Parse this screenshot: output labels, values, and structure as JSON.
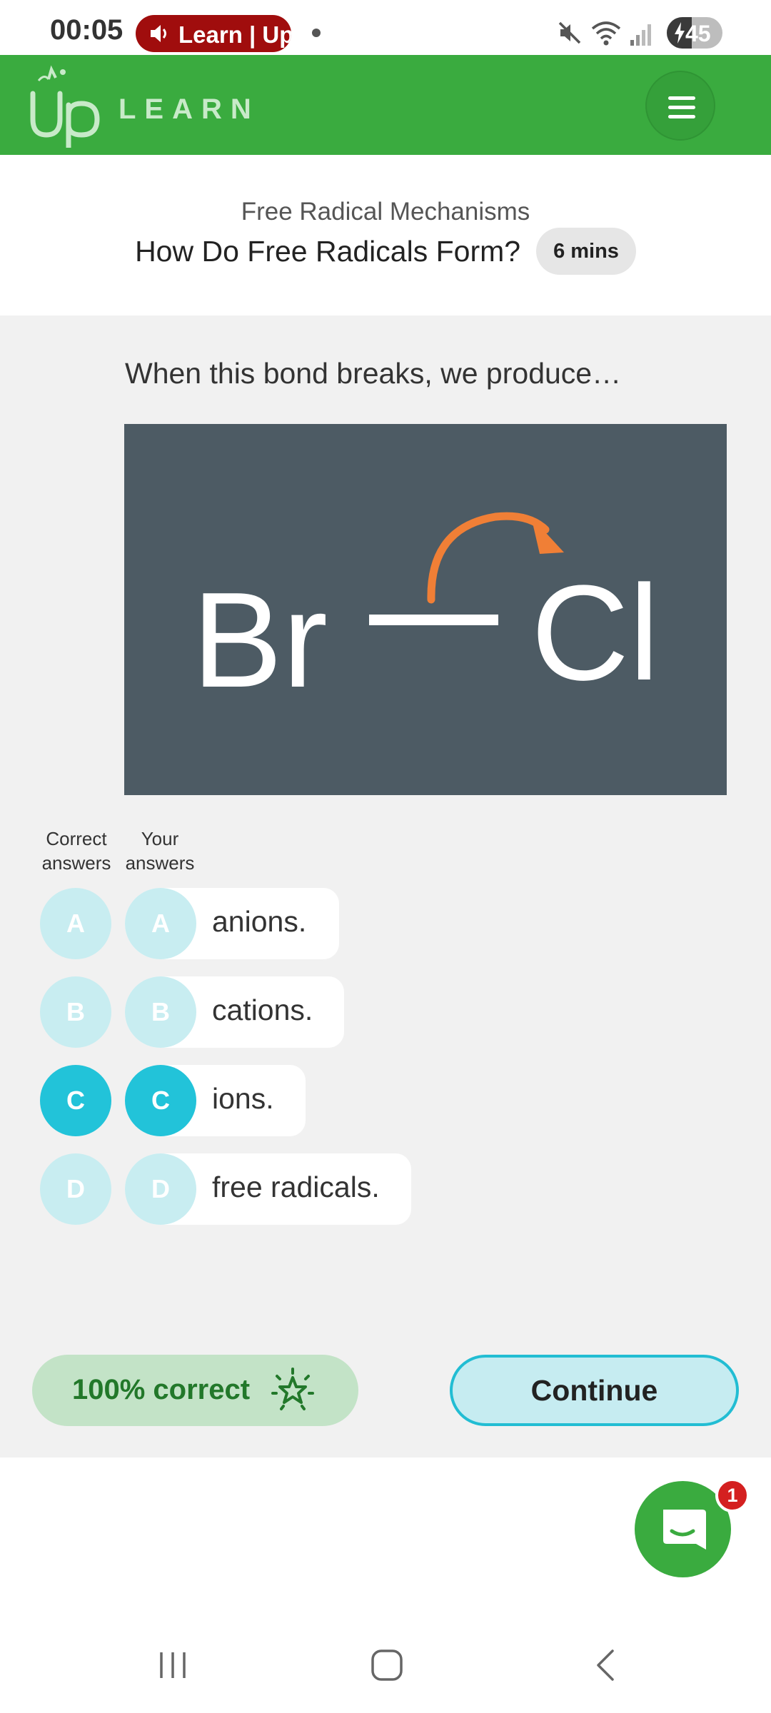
{
  "status_bar": {
    "time": "00:05",
    "media_label": "Learn | Up",
    "battery_level": "45",
    "battery_fraction": 0.45,
    "icons": [
      "speaker-icon",
      "mute-icon",
      "wifi-icon",
      "signal-icon",
      "battery-charging-icon"
    ]
  },
  "header": {
    "brand_prefix": "Up",
    "brand_word": "LEARN",
    "menu_icon": "hamburger-menu-icon"
  },
  "lesson": {
    "subtitle": "Free Radical Mechanisms",
    "title": "How Do Free Radicals Form?",
    "duration": "6 mins"
  },
  "question": {
    "prompt": "When this bond breaks, we produce…",
    "image": {
      "left_atom": "Br",
      "right_atom": "Cl",
      "arrow_icon": "curved-arrow-icon"
    }
  },
  "answers": {
    "correct_header": "Correct answers",
    "your_header": "Your answers",
    "options": [
      {
        "letter": "A",
        "text": "anions.",
        "selected": false
      },
      {
        "letter": "B",
        "text": "cations.",
        "selected": false
      },
      {
        "letter": "C",
        "text": "ions.",
        "selected": true
      },
      {
        "letter": "D",
        "text": "free radicals.",
        "selected": false
      }
    ]
  },
  "result": {
    "score_label": "100% correct",
    "score_icon": "star-burst-icon",
    "continue_label": "Continue"
  },
  "chat": {
    "icon": "chat-bubble-icon",
    "badge_count": "1"
  },
  "colors": {
    "brand_green": "#3aab3f",
    "accent_teal": "#22c3d9",
    "soft_teal": "#c8edf1",
    "score_green": "#22782a",
    "image_bg": "#4d5b64",
    "arrow_orange": "#f07f36"
  },
  "nav_bar": {
    "icons": [
      "recent-apps-icon",
      "home-icon",
      "back-icon"
    ]
  }
}
